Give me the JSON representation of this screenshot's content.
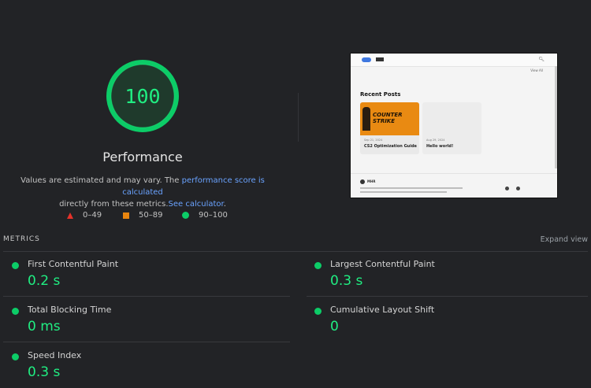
{
  "score": {
    "value": "100",
    "title": "Performance",
    "color": "#20ee82"
  },
  "description": {
    "text_before": "Values are estimated and may vary. The ",
    "link_score": "performance score is calculated",
    "text_middle": " directly from these metrics.",
    "link_calc": "See calculator",
    "text_end": "."
  },
  "legend": [
    {
      "icon": "triangle-icon",
      "range": "0–49",
      "color": "#e5322a"
    },
    {
      "icon": "square-icon",
      "range": "50–89",
      "color": "#e8850f"
    },
    {
      "icon": "circle-icon",
      "range": "90–100",
      "color": "#0ccc67"
    }
  ],
  "screenshot": {
    "heading": "Recent Posts",
    "view_all": "View All",
    "posts": [
      {
        "art_line1": "COUNTER",
        "art_line2": "STRIKE",
        "date": "Sep 21, 2024",
        "title": "CS2 Optimization Guide"
      },
      {
        "date": "Aug 29, 2024",
        "title": "Hello world!"
      }
    ],
    "footer_name": "MHR"
  },
  "metrics": {
    "header": "METRICS",
    "expand_label": "Expand view",
    "items": [
      {
        "label": "First Contentful Paint",
        "value": "0.2 s"
      },
      {
        "label": "Largest Contentful Paint",
        "value": "0.3 s"
      },
      {
        "label": "Total Blocking Time",
        "value": "0 ms"
      },
      {
        "label": "Cumulative Layout Shift",
        "value": "0"
      },
      {
        "label": "Speed Index",
        "value": "0.3 s"
      }
    ]
  }
}
